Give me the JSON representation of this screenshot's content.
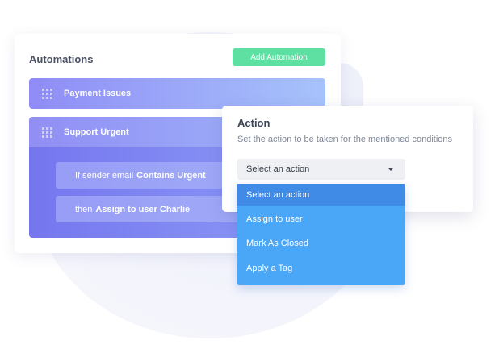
{
  "automations": {
    "title": "Automations",
    "add_button": "Add Automation",
    "rules": [
      {
        "label": "Payment Issues"
      },
      {
        "label": "Support Urgent",
        "conditions": [
          {
            "prefix": "If sender email",
            "bold": "Contains Urgent"
          },
          {
            "prefix": "then",
            "bold": "Assign to user Charlie"
          }
        ]
      }
    ]
  },
  "action_panel": {
    "title": "Action",
    "description": "Set the action to be taken for the mentioned conditions",
    "select_value": "Select an action",
    "options": [
      "Select an action",
      "Assign to user",
      "Mark As Closed",
      "Apply a Tag"
    ],
    "highlighted_option_index": 0
  },
  "colors": {
    "add_button": "#5fe0a3",
    "rule_gradient_start": "#8f8cf6",
    "rule_gradient_end": "#a7c3fb",
    "dropdown_bg": "#4aa6f6",
    "dropdown_active": "#3f8be6"
  },
  "icons": {
    "rule_handle": "grip-icon",
    "select_caret": "caret-down-icon"
  }
}
